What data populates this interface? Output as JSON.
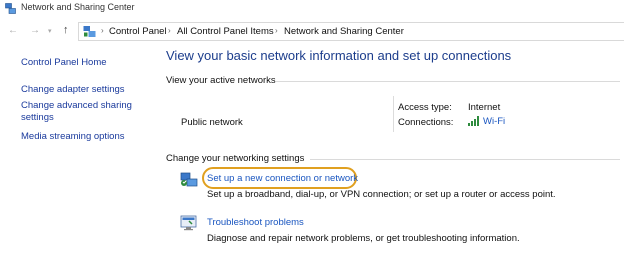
{
  "window": {
    "title": "Network and Sharing Center"
  },
  "address_bar": {
    "back_icon": "arrow-left-icon",
    "forward_icon": "arrow-right-icon",
    "up_icon": "arrow-up-icon",
    "breadcrumbs": [
      "Control Panel",
      "All Control Panel Items",
      "Network and Sharing Center"
    ]
  },
  "sidebar": {
    "items": [
      {
        "label": "Control Panel Home"
      },
      {
        "label": "Change adapter settings"
      },
      {
        "label": "Change advanced sharing settings"
      },
      {
        "label": "Media streaming options"
      }
    ]
  },
  "main": {
    "title": "View your basic network information and set up connections",
    "active_networks": {
      "heading": "View your active networks",
      "network_name": "Public network",
      "access_type_label": "Access type:",
      "access_type_value": "Internet",
      "connections_label": "Connections:",
      "connections_value": "Wi-Fi"
    },
    "networking_settings": {
      "heading": "Change your networking settings",
      "tasks": [
        {
          "icon": "network-setup-icon",
          "link": "Set up a new connection or network",
          "description": "Set up a broadband, dial-up, or VPN connection; or set up a router or access point."
        },
        {
          "icon": "troubleshoot-icon",
          "link": "Troubleshoot problems",
          "description": "Diagnose and repair network problems, or get troubleshooting information."
        }
      ]
    }
  },
  "colors": {
    "link": "#1a56c0",
    "title": "#1c3d8c",
    "sidebar_link": "#1a3a9c",
    "highlight": "#e0a020"
  }
}
